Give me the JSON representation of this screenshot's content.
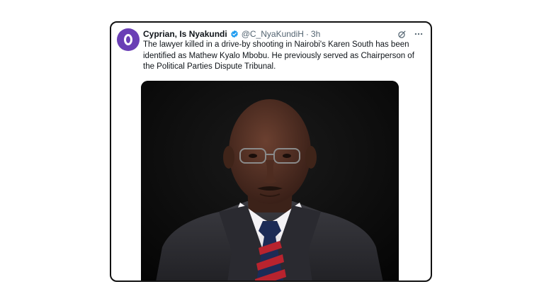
{
  "tweet": {
    "display_name": "Cyprian, Is Nyakundi",
    "handle": "@C_NyaKundiH",
    "separator": "·",
    "time": "3h",
    "text": "The lawyer killed in a drive-by shooting in Nairobi's Karen South has been identified as Mathew Kyalo Mbobu. He previously served as Chairperson of the Political Parties Dispute Tribunal.",
    "media_alt": "portrait of man in suit and striped tie"
  },
  "icons": {
    "avatar": "avatar-logo",
    "verified": "verified-badge-icon",
    "grok": "grok-icon",
    "more": "more-icon"
  },
  "colors": {
    "accent": "#1d9bf0",
    "avatar": "#6a3fb5",
    "muted": "#536471",
    "text": "#0f1419"
  }
}
